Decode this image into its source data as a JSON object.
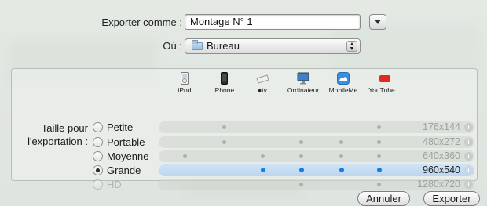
{
  "form": {
    "export_as_label": "Exporter comme :",
    "export_as_value": "Montage N° 1",
    "where_label": "Où :",
    "where_value": "Bureau"
  },
  "devices": [
    {
      "label": "iPod",
      "icon": "ipod-icon"
    },
    {
      "label": "iPhone",
      "icon": "iphone-icon"
    },
    {
      "label": "tv",
      "icon": "appletv-icon"
    },
    {
      "label": "Ordinateur",
      "icon": "computer-icon"
    },
    {
      "label": "MobileMe",
      "icon": "mobileme-icon"
    },
    {
      "label": "YouTube",
      "icon": "youtube-icon"
    }
  ],
  "size_label_line1": "Taille pour",
  "size_label_line2": "l'exportation :",
  "sizes": [
    {
      "label": "Petite",
      "resolution": "176x144",
      "selected": false,
      "enabled": true,
      "dots": [
        false,
        true,
        false,
        false,
        true,
        false
      ]
    },
    {
      "label": "Portable",
      "resolution": "480x272",
      "selected": false,
      "enabled": true,
      "dots": [
        false,
        true,
        false,
        true,
        true,
        true
      ]
    },
    {
      "label": "Moyenne",
      "resolution": "640x360",
      "selected": false,
      "enabled": true,
      "dots": [
        true,
        false,
        true,
        true,
        true,
        true
      ]
    },
    {
      "label": "Grande",
      "resolution": "960x540",
      "selected": true,
      "enabled": true,
      "dots": [
        false,
        false,
        true,
        true,
        true,
        true
      ]
    },
    {
      "label": "HD",
      "resolution": "1280x720",
      "selected": false,
      "enabled": false,
      "dots": [
        false,
        false,
        false,
        true,
        false,
        true
      ]
    }
  ],
  "buttons": {
    "cancel": "Annuler",
    "export": "Exporter"
  },
  "colors": {
    "selection_dot": "#1e7be0",
    "youtube_red": "#e02a1f"
  }
}
